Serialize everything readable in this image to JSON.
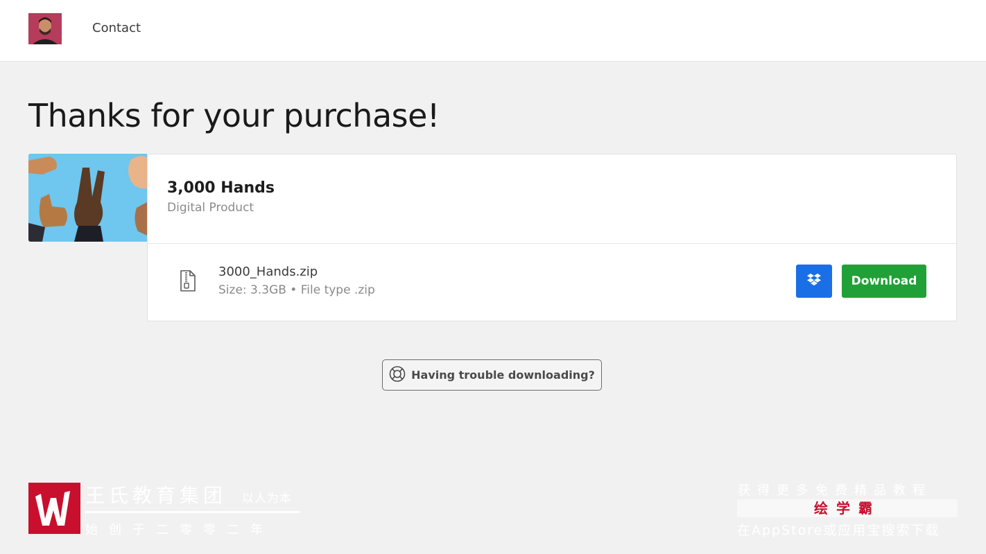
{
  "header": {
    "contact_label": "Contact"
  },
  "page": {
    "title": "Thanks for your purchase!"
  },
  "product": {
    "name": "3,000 Hands",
    "type": "Digital Product",
    "file": {
      "name": "3000_Hands.zip",
      "meta": "Size: 3.3GB • File type .zip"
    },
    "download_label": "Download"
  },
  "help": {
    "label": "Having trouble downloading?"
  },
  "watermark": {
    "name": "王氏教育集团",
    "slogan": "以人为本",
    "sub": "始创于二零零二年",
    "right_line1": "获得更多免费精品教程",
    "right_line2": "绘学霸",
    "right_line3": "在AppStore或应用宝搜索下载"
  },
  "colors": {
    "dropbox": "#1a6fe6",
    "download": "#21a037",
    "brand_red": "#c8102e"
  },
  "icons": {
    "file": "zip-file-icon",
    "dropbox": "dropbox-icon",
    "help": "lifebuoy-icon"
  }
}
